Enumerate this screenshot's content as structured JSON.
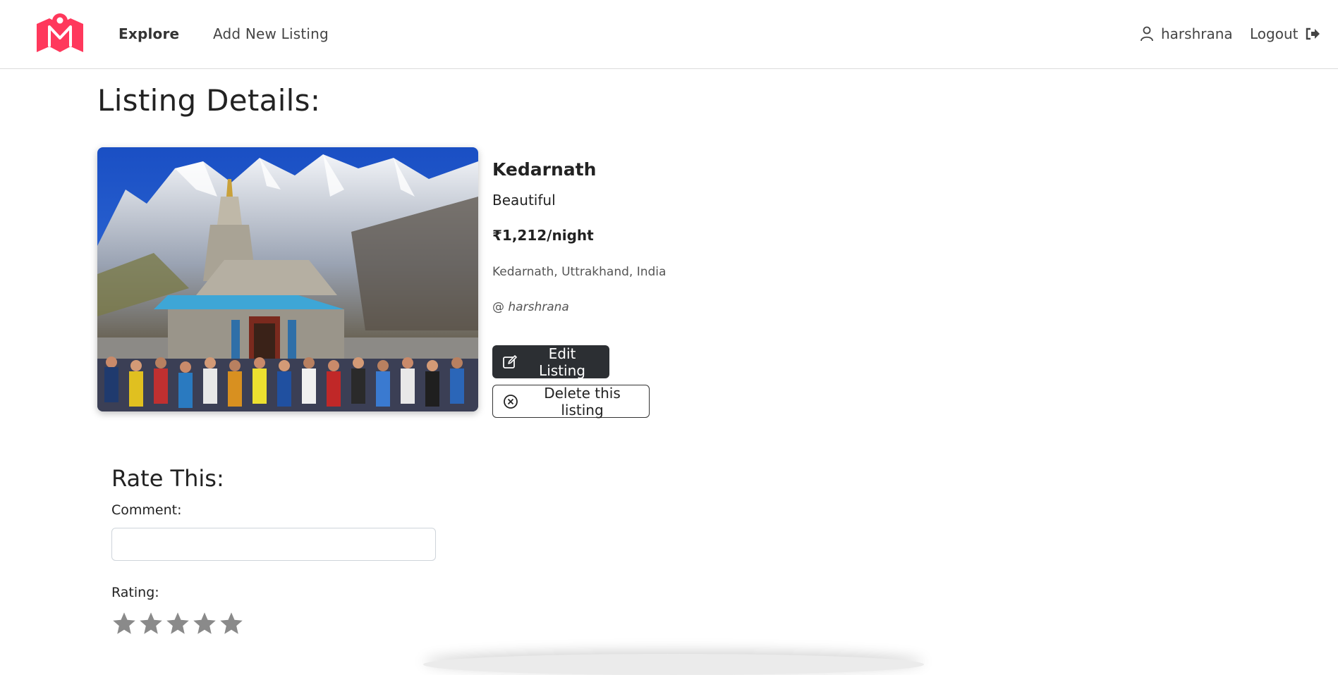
{
  "nav": {
    "explore_label": "Explore",
    "add_listing_label": "Add New Listing",
    "username": "harshrana",
    "logout_label": "Logout",
    "brand_color": "#ff385c"
  },
  "page": {
    "title": "Listing Details:"
  },
  "listing": {
    "title": "Kedarnath",
    "description": "Beautiful",
    "price": "₹1,212/night",
    "location": "Kedarnath, Uttrakhand, India",
    "owner_prefix": "@",
    "owner": "harshrana",
    "image_icon": "temple-mountain-photo"
  },
  "actions": {
    "edit_label": "Edit Listing",
    "delete_label": "Delete this listing"
  },
  "review": {
    "title": "Rate This:",
    "comment_label": "Comment:",
    "comment_value": "",
    "rating_label": "Rating:",
    "rating_value": 0,
    "rating_max": 5
  }
}
